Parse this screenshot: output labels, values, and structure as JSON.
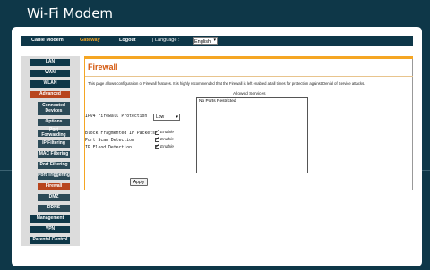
{
  "app_title": "Wi-Fi Modem",
  "topnav": {
    "cable_modem": "Cable Modem",
    "gateway": "Gateway",
    "logout": "Logout",
    "language_label": "| Language :",
    "language_value": "English"
  },
  "sidebar": {
    "lan": "LAN",
    "wan": "WAN",
    "wlan": "WLAN",
    "advanced": "Advanced",
    "connected_devices": "Connected Devices",
    "options": "Options",
    "port_forwarding": "Port Forwarding",
    "ip_filtering": "IP Filtering",
    "mac_filtering": "MAC Filtering",
    "port_filtering": "Port Filtering",
    "port_triggering": "Port Triggering",
    "firewall": "Firewall",
    "dmz": "DMZ",
    "ddns": "DDNS",
    "management": "Management",
    "vpn": "VPN",
    "parental_control": "Parental Control"
  },
  "main": {
    "title": "Firewall",
    "description": "This page allows configuration of Firewall features. It is highly recommended that the Firewall is left enabled at all times for protection against Denial of Service attacks.",
    "ipv4_label": "IPv4 Firewall Protection",
    "ipv4_value": "Low",
    "block_frag_label": "Block Fragmented IP Packets",
    "port_scan_label": "Port Scan Detection",
    "ip_flood_label": "IP Flood Detection",
    "enable": "Enable",
    "allowed_services_label": "Allowed Services",
    "allowed_services": [
      "No Ports Restricted"
    ],
    "apply": "Apply"
  }
}
